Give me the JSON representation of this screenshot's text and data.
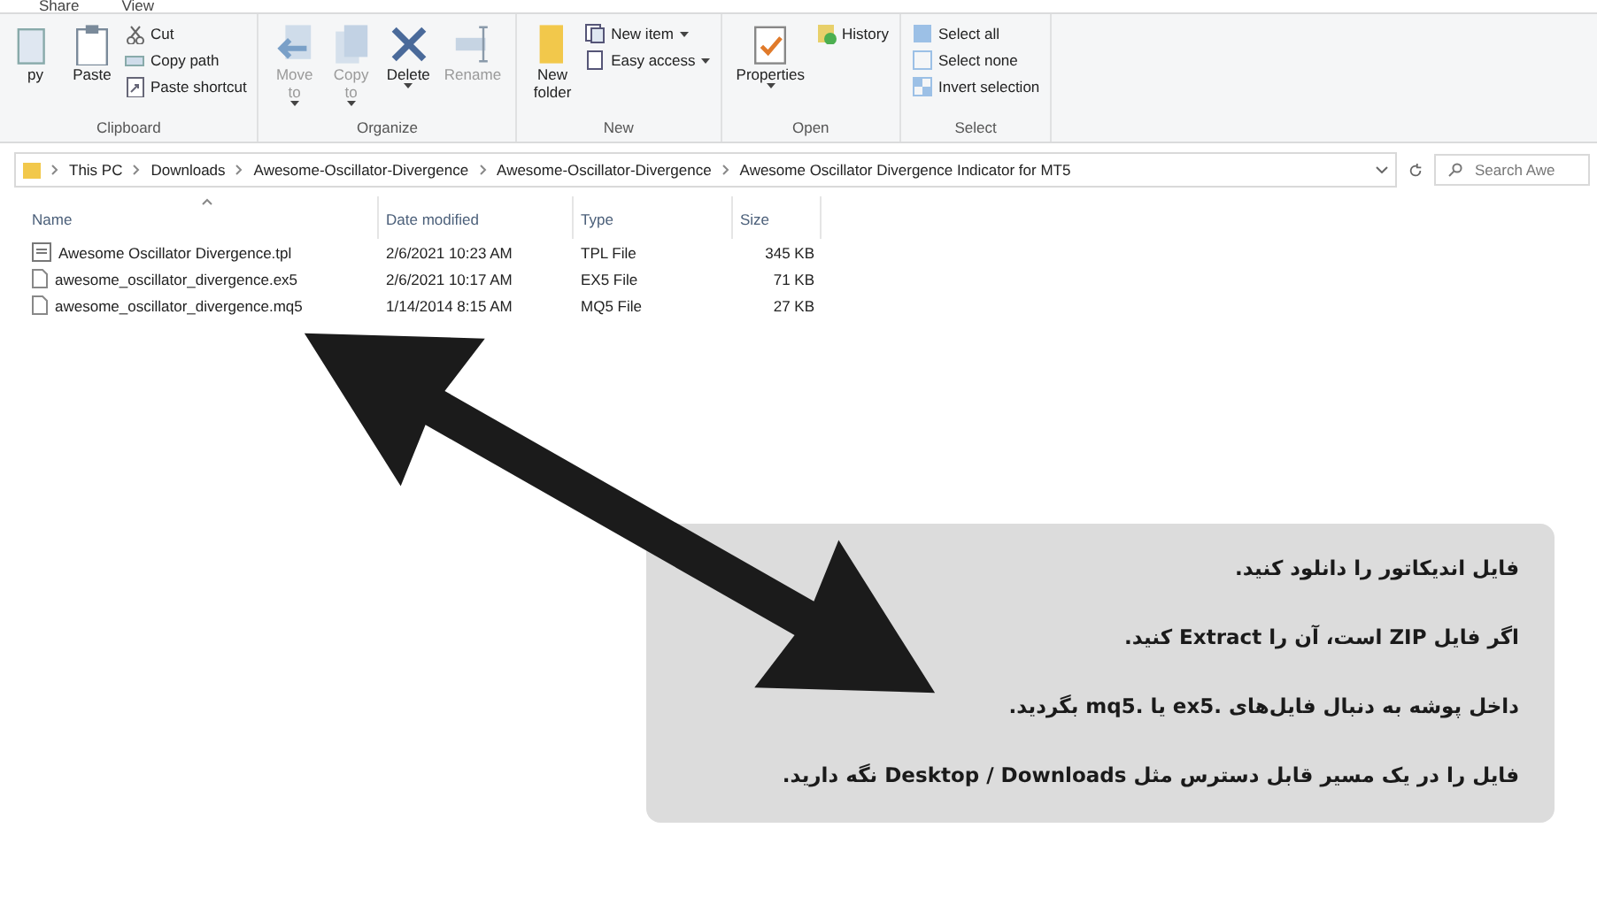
{
  "ribbon_tabs": [
    {
      "label": "Share"
    },
    {
      "label": "View"
    }
  ],
  "ribbon_groups": [
    {
      "label": "Clipboard",
      "commands": [
        {
          "kind": "large",
          "lines": [
            "py"
          ],
          "disabled": false,
          "menu": false
        },
        {
          "kind": "large",
          "lines": [
            "Paste"
          ],
          "disabled": false,
          "menu": false
        },
        {
          "kind": "small",
          "label": "Cut",
          "disabled": false,
          "menu": false
        },
        {
          "kind": "small",
          "label": "Copy path",
          "disabled": false,
          "menu": false
        },
        {
          "kind": "small",
          "label": "Paste shortcut",
          "disabled": false,
          "menu": false
        }
      ]
    },
    {
      "label": "Organize",
      "commands": [
        {
          "kind": "large",
          "lines": [
            "Move",
            "to"
          ],
          "disabled": true,
          "menu": true
        },
        {
          "kind": "large",
          "lines": [
            "Copy",
            "to"
          ],
          "disabled": true,
          "menu": true
        },
        {
          "kind": "large",
          "lines": [
            "Delete"
          ],
          "disabled": false,
          "menu": true
        },
        {
          "kind": "large",
          "lines": [
            "Rename"
          ],
          "disabled": true,
          "menu": false
        }
      ]
    },
    {
      "label": "New",
      "commands": [
        {
          "kind": "large",
          "lines": [
            "New",
            "folder"
          ],
          "disabled": false,
          "menu": false
        },
        {
          "kind": "small",
          "label": "New item",
          "disabled": false,
          "menu": true
        },
        {
          "kind": "small",
          "label": "Easy access",
          "disabled": false,
          "menu": true
        }
      ]
    },
    {
      "label": "Open",
      "commands": [
        {
          "kind": "large",
          "lines": [
            "Properties"
          ],
          "disabled": false,
          "menu": true
        },
        {
          "kind": "small",
          "label": "History",
          "disabled": false,
          "menu": false
        }
      ]
    },
    {
      "label": "Select",
      "commands": [
        {
          "kind": "small",
          "label": "Select all",
          "disabled": false,
          "menu": false
        },
        {
          "kind": "small",
          "label": "Select none",
          "disabled": false,
          "menu": false
        },
        {
          "kind": "small",
          "label": "Invert selection",
          "disabled": false,
          "menu": false
        }
      ]
    }
  ],
  "address_bar": {
    "path": [
      "This PC",
      "Downloads",
      "Awesome-Oscillator-Divergence",
      "Awesome-Oscillator-Divergence",
      "Awesome Oscillator Divergence Indicator for MT5"
    ]
  },
  "search": {
    "placeholder": "Search Awe"
  },
  "table": {
    "columns": [
      {
        "label": "Name",
        "sorted": true
      },
      {
        "label": "Date modified",
        "sorted": false
      },
      {
        "label": "Type",
        "sorted": false
      },
      {
        "label": "Size",
        "sorted": false
      }
    ],
    "rows": [
      {
        "kind": "template",
        "name": "Awesome Oscillator Divergence.tpl",
        "date": "2/6/2021 10:23 AM",
        "type": "TPL File",
        "size": "345 KB"
      },
      {
        "kind": "file",
        "name": "awesome_oscillator_divergence.ex5",
        "date": "2/6/2021 10:17 AM",
        "type": "EX5 File",
        "size": "71 KB"
      },
      {
        "kind": "file",
        "name": "awesome_oscillator_divergence.mq5",
        "date": "1/14/2014 8:15 AM",
        "type": "MQ5 File",
        "size": "27 KB"
      }
    ]
  },
  "callout": {
    "paragraphs": [
      "فایل اندیکاتور را دانلود کنید.",
      "اگر فایل ZIP است، آن را Extract کنید.",
      "داخل پوشه به دنبال فایل‌های .ex5 یا .mq5 بگردید.",
      "فایل را در یک مسیر قابل دسترس مثل Desktop / Downloads نگه دارید."
    ]
  }
}
